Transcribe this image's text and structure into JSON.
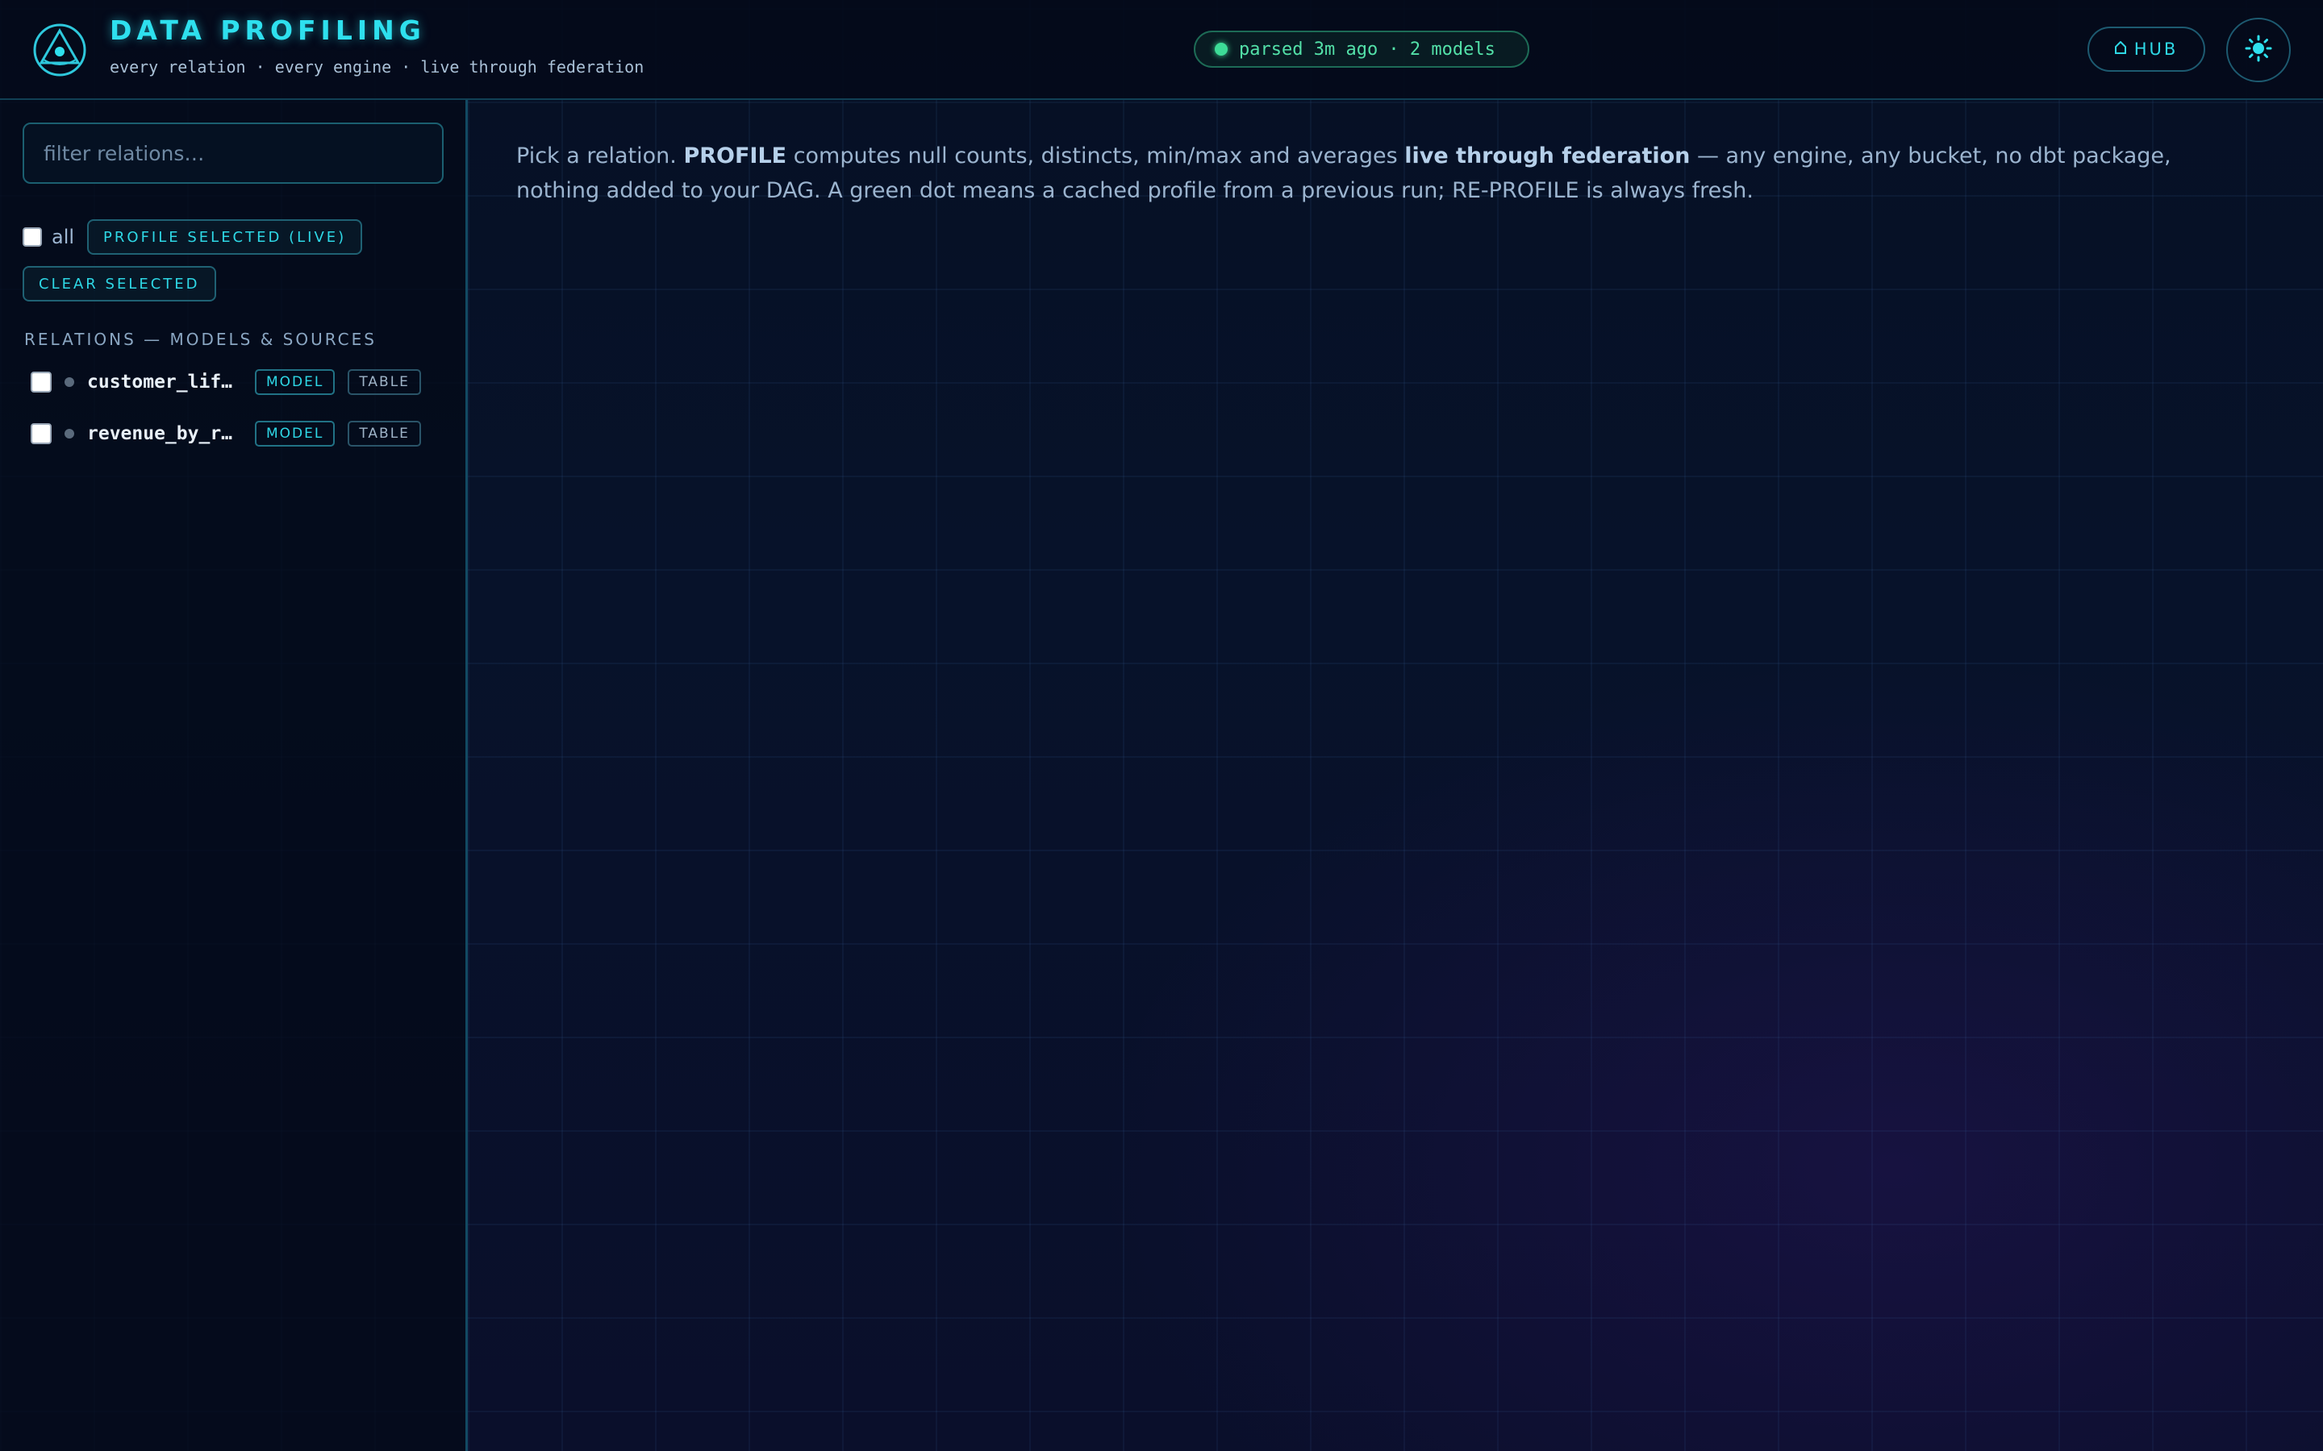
{
  "header": {
    "title": "DATA PROFILING",
    "subtitle": "every relation · every engine · live through federation",
    "status": "parsed 3m ago · 2 models",
    "hub_label": "HUB",
    "icons": {
      "logo": "triangle-eye-logo",
      "hub": "home-icon",
      "theme": "sun-icon"
    }
  },
  "sidebar": {
    "filter_placeholder": "filter relations…",
    "select_all_label": "all",
    "profile_selected_label": "PROFILE SELECTED (LIVE)",
    "clear_selected_label": "CLEAR SELECTED",
    "section_title": "RELATIONS — MODELS & SOURCES",
    "relations": [
      {
        "name": "customer_lifetime_value",
        "kind": "MODEL",
        "materialization": "TABLE"
      },
      {
        "name": "revenue_by_region",
        "kind": "MODEL",
        "materialization": "TABLE"
      }
    ]
  },
  "main": {
    "intro_1": "Pick a relation. ",
    "intro_profile": "PROFILE",
    "intro_2": " computes null counts, distincts, min/max and averages ",
    "intro_live": "live through federation",
    "intro_3": " — any engine, any bucket, no dbt package, nothing added to your DAG. A green dot means a cached profile from a previous run; RE-PROFILE is always fresh."
  },
  "colors": {
    "accent": "#2ee0ee",
    "status_green": "#3ddc97",
    "background": "#061024",
    "border": "#124a63"
  }
}
